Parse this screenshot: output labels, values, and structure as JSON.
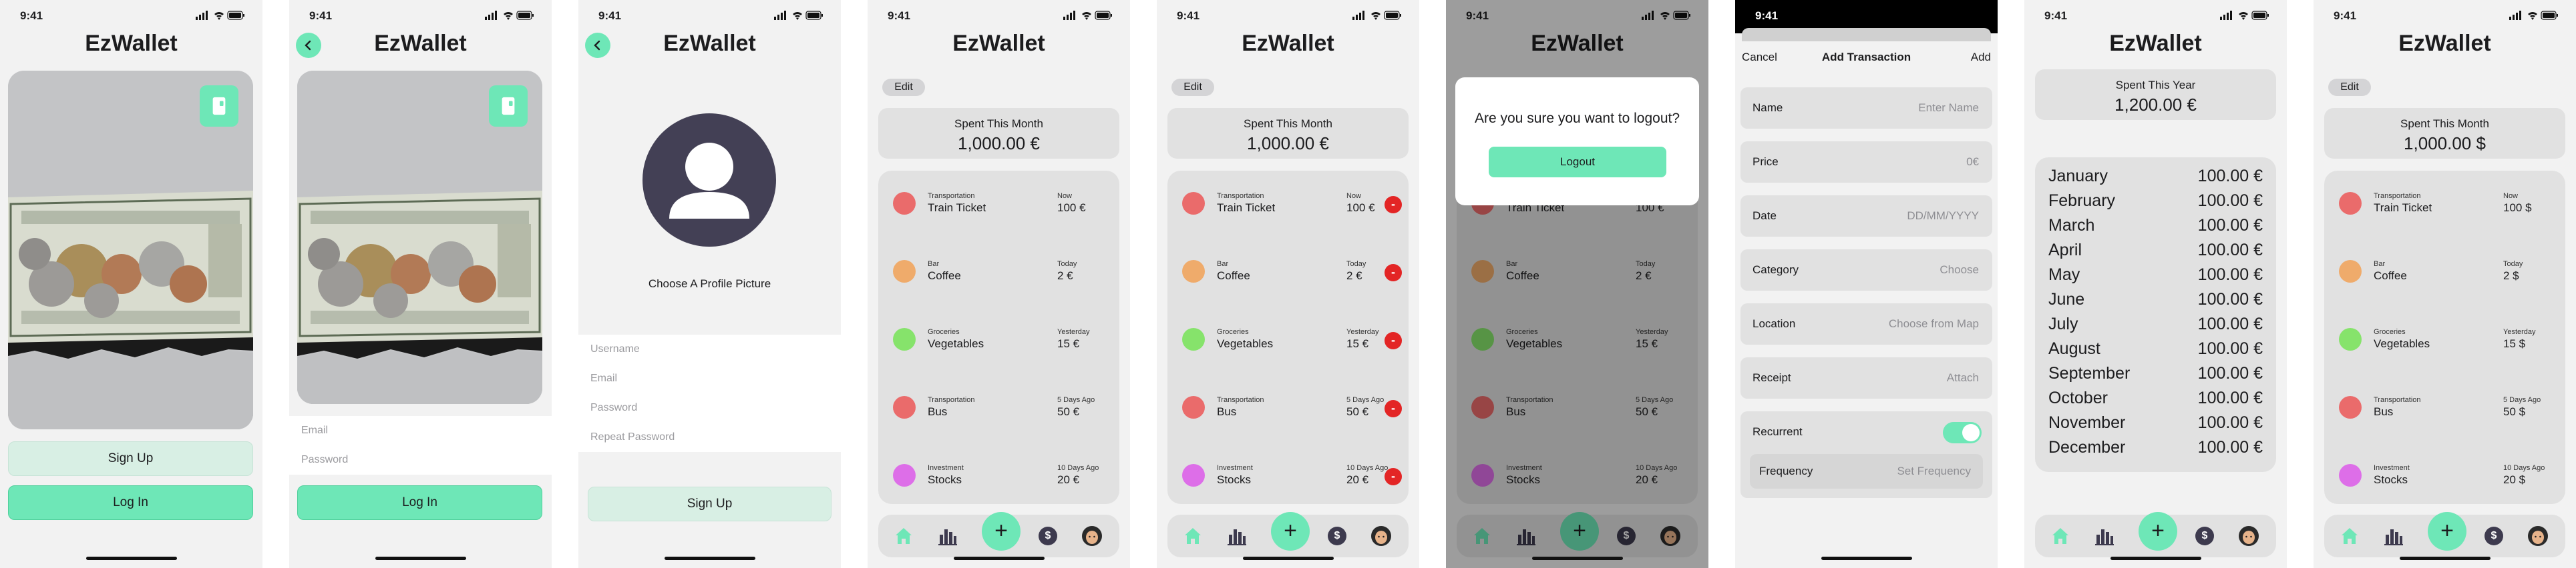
{
  "app": {
    "title": "EzWallet",
    "time": "9:41"
  },
  "login": {
    "signup": "Sign Up",
    "login": "Log In"
  },
  "login_form": {
    "email": "Email",
    "password": "Password",
    "login": "Log In"
  },
  "signup_form": {
    "caption": "Choose A Profile Picture",
    "username": "Username",
    "email": "Email",
    "password": "Password",
    "repeat": "Repeat Password",
    "signup": "Sign Up"
  },
  "dashboard": {
    "edit": "Edit",
    "summary_label": "Spent This Month",
    "summary_value": "1,000.00 €",
    "transactions": [
      {
        "category": "Transportation",
        "name": "Train Ticket",
        "when": "Now",
        "amount": "100 €",
        "color": "#ea6b6b"
      },
      {
        "category": "Bar",
        "name": "Coffee",
        "when": "Today",
        "amount": "2 €",
        "color": "#efab6b"
      },
      {
        "category": "Groceries",
        "name": "Vegetables",
        "when": "Yesterday",
        "amount": "15 €",
        "color": "#86e36b"
      },
      {
        "category": "Transportation",
        "name": "Bus",
        "when": "5 Days Ago",
        "amount": "50 €",
        "color": "#ea6b6b"
      },
      {
        "category": "Investment",
        "name": "Stocks",
        "when": "10 Days Ago",
        "amount": "20 €",
        "color": "#dd6ee8"
      }
    ],
    "delete": "-",
    "plus": "+",
    "dollar": "$"
  },
  "logout": {
    "question": "Are you sure you want to logout?",
    "button": "Logout"
  },
  "add_tx": {
    "cancel": "Cancel",
    "heading": "Add Transaction",
    "add": "Add",
    "rows": [
      {
        "label": "Name",
        "value": "Enter Name"
      },
      {
        "label": "Price",
        "value": "0€"
      },
      {
        "label": "Date",
        "value": "DD/MM/YYYY"
      },
      {
        "label": "Category",
        "value": "Choose"
      },
      {
        "label": "Location",
        "value": "Choose from Map"
      },
      {
        "label": "Receipt",
        "value": "Attach"
      }
    ],
    "recurrent": "Recurrent",
    "frequency": "Frequency",
    "frequency_value": "Set Frequency"
  },
  "yearly": {
    "label": "Spent This Year",
    "value": "1,200.00 €",
    "months": [
      {
        "m": "January",
        "v": "100.00 €"
      },
      {
        "m": "February",
        "v": "100.00 €"
      },
      {
        "m": "March",
        "v": "100.00 €"
      },
      {
        "m": "April",
        "v": "100.00 €"
      },
      {
        "m": "May",
        "v": "100.00 €"
      },
      {
        "m": "June",
        "v": "100.00 €"
      },
      {
        "m": "July",
        "v": "100.00 €"
      },
      {
        "m": "August",
        "v": "100.00 €"
      },
      {
        "m": "September",
        "v": "100.00 €"
      },
      {
        "m": "October",
        "v": "100.00 €"
      },
      {
        "m": "November",
        "v": "100.00 €"
      },
      {
        "m": "December",
        "v": "100.00 €"
      }
    ]
  },
  "dashboard_usd": {
    "edit": "Edit",
    "summary_label": "Spent This Month",
    "summary_value": "1,000.00 $",
    "transactions": [
      {
        "category": "Transportation",
        "name": "Train Ticket",
        "when": "Now",
        "amount": "100 $",
        "color": "#ea6b6b"
      },
      {
        "category": "Bar",
        "name": "Coffee",
        "when": "Today",
        "amount": "2 $",
        "color": "#efab6b"
      },
      {
        "category": "Groceries",
        "name": "Vegetables",
        "when": "Yesterday",
        "amount": "15 $",
        "color": "#86e36b"
      },
      {
        "category": "Transportation",
        "name": "Bus",
        "when": "5 Days Ago",
        "amount": "50 $",
        "color": "#ea6b6b"
      },
      {
        "category": "Investment",
        "name": "Stocks",
        "when": "10 Days Ago",
        "amount": "20 $",
        "color": "#dd6ee8"
      }
    ]
  }
}
